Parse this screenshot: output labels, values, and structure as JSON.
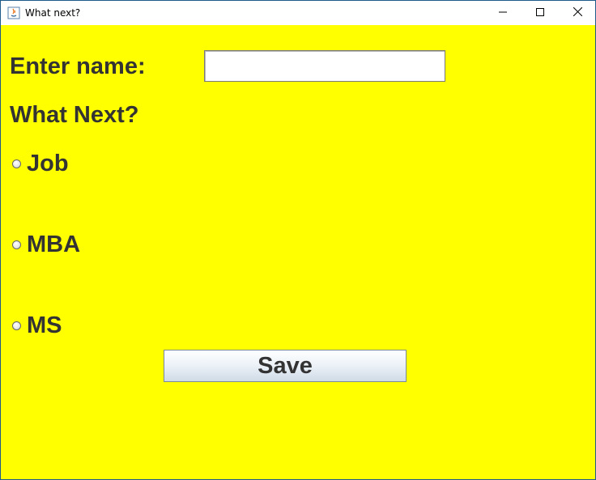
{
  "window": {
    "title": "What next?",
    "controls": {
      "minimize_icon": "minimize-icon",
      "maximize_icon": "maximize-icon",
      "close_icon": "close-icon"
    }
  },
  "form": {
    "name_label": "Enter name:",
    "name_value": "",
    "question": "What Next?",
    "options": [
      {
        "label": "Job",
        "selected": false
      },
      {
        "label": "MBA",
        "selected": false
      },
      {
        "label": "MS",
        "selected": false
      }
    ],
    "save_label": "Save"
  },
  "colors": {
    "background": "#ffff00",
    "text": "#333333"
  }
}
